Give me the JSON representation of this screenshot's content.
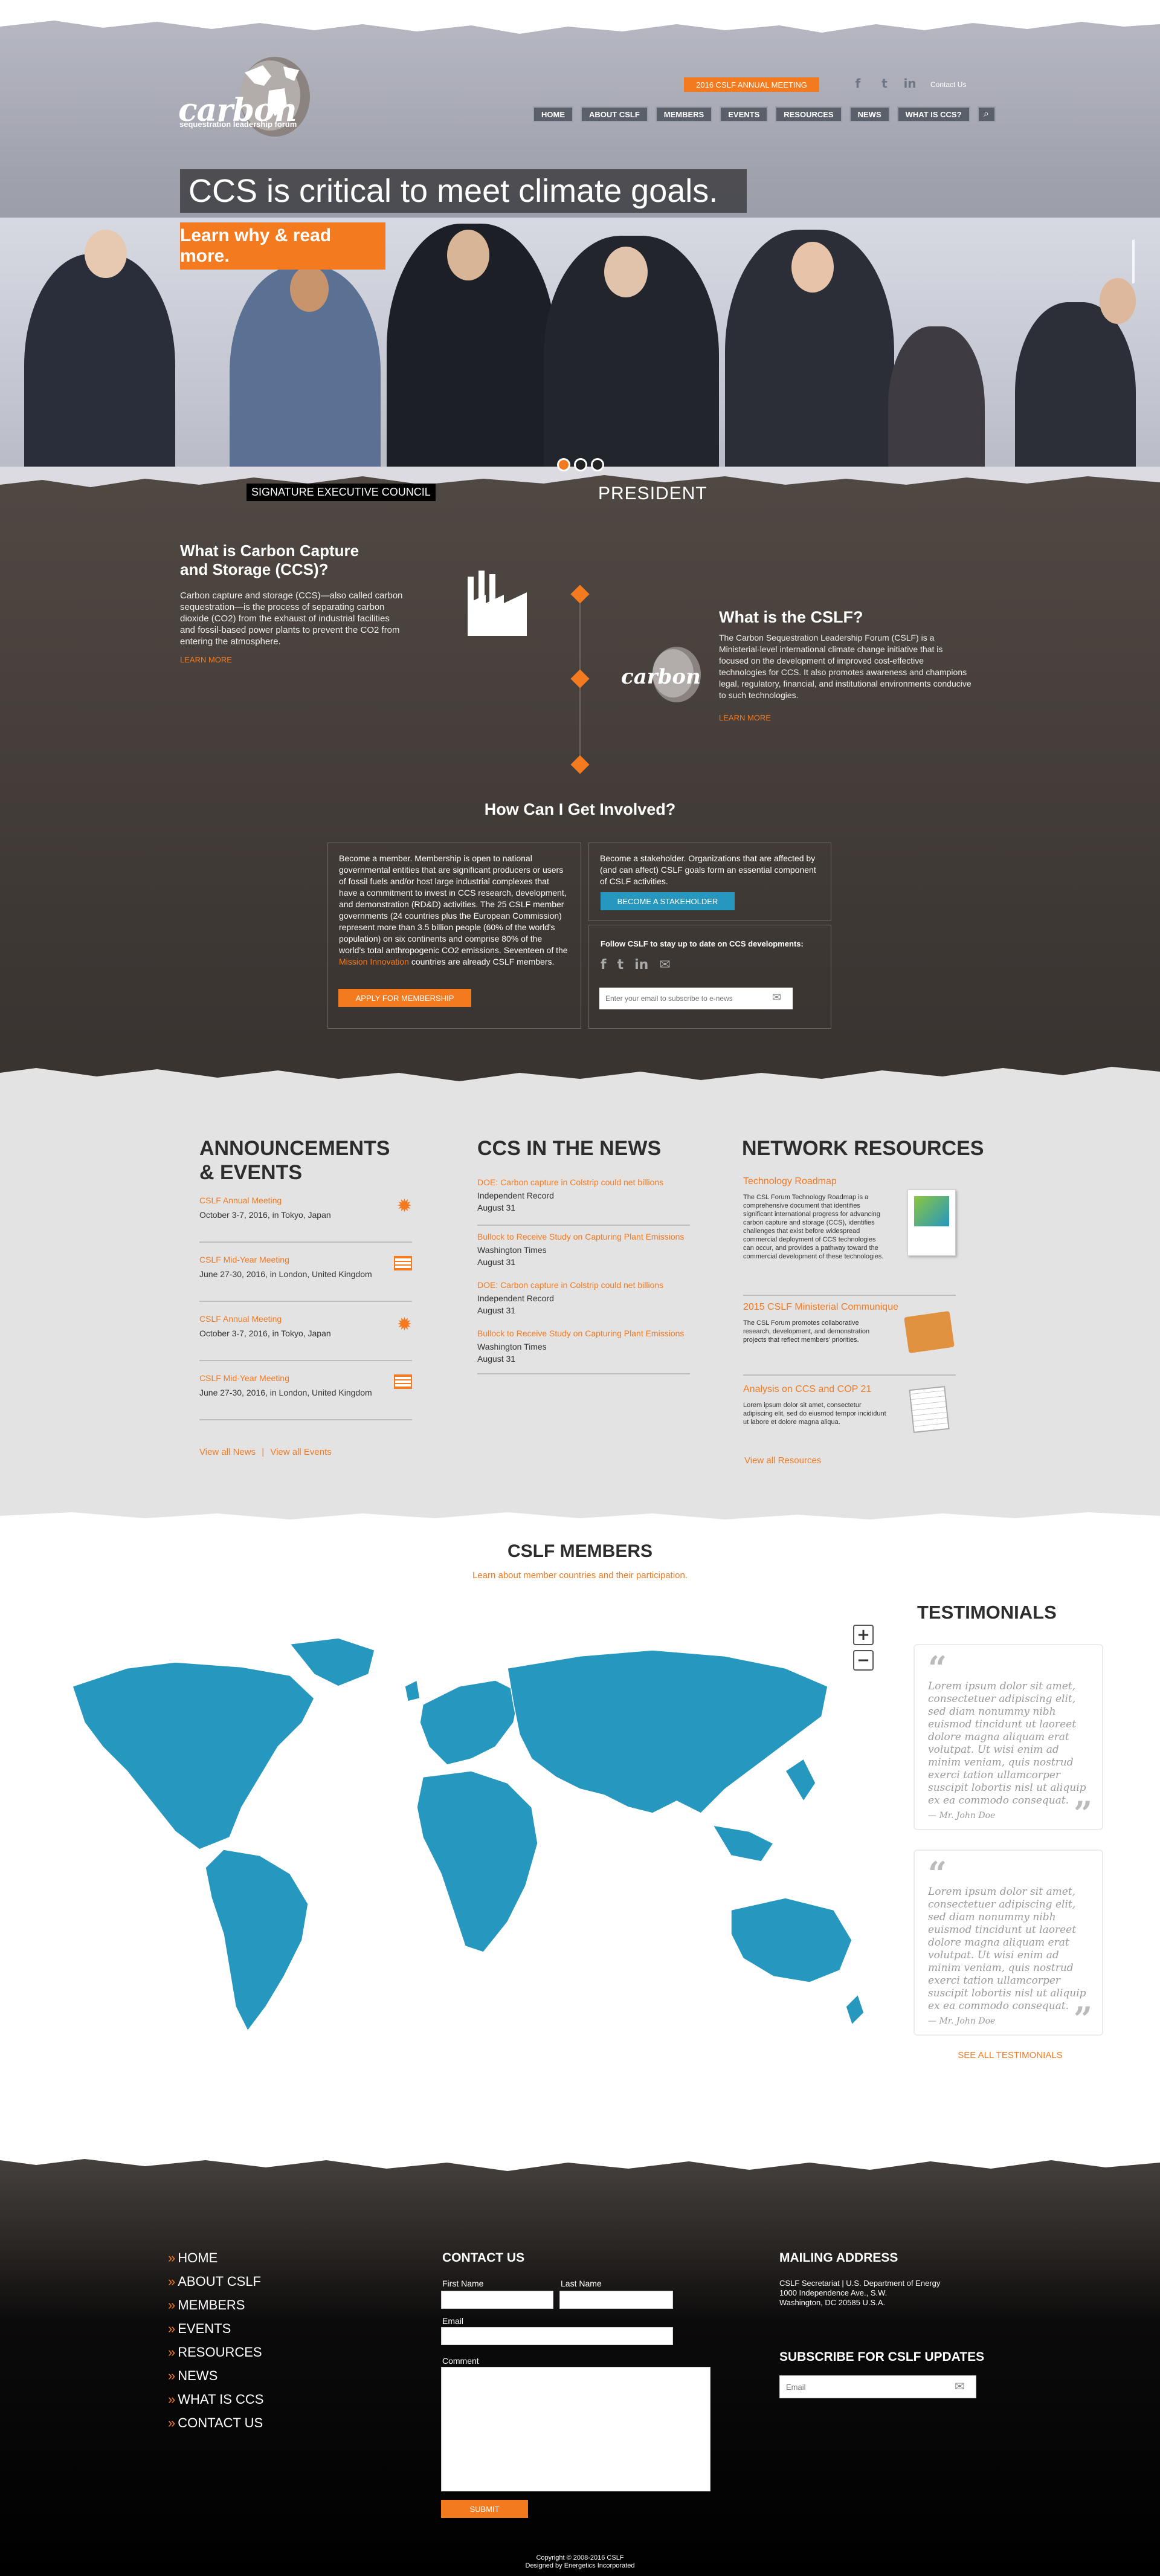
{
  "header": {
    "logo_word": "carbon",
    "logo_sub": "sequestration leadership forum",
    "announcement_button": "2016 CSLF ANNUAL MEETING",
    "contact": "Contact Us",
    "nav": [
      "HOME",
      "ABOUT CSLF",
      "MEMBERS",
      "EVENTS",
      "RESOURCES",
      "NEWS",
      "WHAT IS CCS?"
    ],
    "search_icon": "search-icon",
    "social_icons": [
      "facebook-icon",
      "twitter-icon",
      "linkedin-icon"
    ]
  },
  "hero": {
    "headline": "CCS is critical to meet climate goals.",
    "cta": "Learn why & read more.",
    "caption_left": "SIGNATURE EXECUTIVE COUNCIL",
    "caption_right": "PRESIDENT",
    "slide_count": 3,
    "active_slide": 1
  },
  "ccs": {
    "title": "What is Carbon Capture and Storage (CCS)?",
    "body": "Carbon capture and storage (CCS)—also called carbon sequestration—is the process of separating carbon dioxide (CO2) from the exhaust of industrial facilities and fossil-based power plants to prevent the CO2 from entering the atmosphere.",
    "link": "LEARN MORE",
    "icon": "factory-icon"
  },
  "cslf": {
    "title": "What is the CSLF?",
    "body": "The Carbon Sequestration Leadership Forum (CSLF) is a Ministerial-level international climate change initiative that is focused on the development of improved cost-effective technologies for CCS. It also promotes awareness and champions legal, regulatory, financial, and institutional environments conducive to such technologies.",
    "link": "LEARN MORE"
  },
  "involved": {
    "title": "How Can I Get Involved?",
    "member_text_1": "Become a member. Membership is open to national governmental entities that are significant producers or users of fossil fuels and/or host large industrial complexes that have a commitment to invest in CCS research, development, and demonstration (RD&D) activities. The 25 CSLF member governments (24 countries plus the European Commission) represent more than 3.5 billion people (60% of the world's population) on six continents and comprise 80% of the world's total anthropogenic CO2 emissions. Seventeen of the ",
    "member_link": "Mission Innovation",
    "member_text_2": " countries are already CSLF members.",
    "member_button": "APPLY FOR MEMBERSHIP",
    "stakeholder_text": "Become a stakeholder. Organizations that are affected by (and can affect) CSLF goals form an essential component of CSLF activities.",
    "stakeholder_button": "BECOME A STAKEHOLDER",
    "follow_text": "Follow CSLF to stay up to date on CCS developments:",
    "email_placeholder": "Enter your email to subscribe to e-news"
  },
  "announcements": {
    "title": "ANNOUNCEMENTS & EVENTS",
    "items": [
      {
        "title": "CSLF Annual Meeting",
        "date": "October 3-7, 2016, in Tokyo, Japan",
        "icon": "sun-icon"
      },
      {
        "title": "CSLF Mid-Year Meeting",
        "date": "June 27-30, 2016, in London, United Kingdom",
        "icon": "flag-icon"
      },
      {
        "title": "CSLF Annual Meeting",
        "date": "October 3-7, 2016, in Tokyo, Japan",
        "icon": "sun-icon"
      },
      {
        "title": "CSLF Mid-Year Meeting",
        "date": "June 27-30, 2016, in London, United Kingdom",
        "icon": "flag-icon"
      }
    ],
    "view_news": "View all News",
    "divider": "|",
    "view_events": "View all Events"
  },
  "news": {
    "title": "CCS IN THE NEWS",
    "items": [
      {
        "title": "DOE: Carbon capture in Colstrip could net billions",
        "source": "Independent Record",
        "date": "August 31"
      },
      {
        "title": "Bullock to Receive Study on Capturing Plant Emissions",
        "source": "Washington Times",
        "date": "August 31"
      },
      {
        "title": "DOE: Carbon capture in Colstrip could net billions",
        "source": "Independent Record",
        "date": "August 31"
      },
      {
        "title": "Bullock to Receive Study on Capturing Plant Emissions",
        "source": "Washington Times",
        "date": "August 31"
      }
    ]
  },
  "resources": {
    "title": "NETWORK RESOURCES",
    "items": [
      {
        "title": "Technology Roadmap",
        "body": "The CSL Forum Technology Roadmap is a comprehensive document that identifies significant international progress for advancing carbon capture and storage (CCS), identifies challenges that exist before widespread commercial deployment of CCS technologies can occur, and provides a pathway toward the commercial development of these technologies.",
        "icon": "document-thumbnail-icon"
      },
      {
        "title": "2015 CSLF Ministerial Communique",
        "body": "The CSL Forum promotes collaborative research, development, and demonstration projects that reflect members' priorities.",
        "icon": "folder-icon"
      },
      {
        "title": "Analysis on CCS and COP 21",
        "body": "Lorem ipsum dolor sit amet, consectetur adipiscing elit, sed do eiusmod tempor incididunt ut labore et dolore magna aliqua.",
        "icon": "paper-icon"
      }
    ],
    "view_all": "View all Resources"
  },
  "members": {
    "title": "CSLF MEMBERS",
    "subtitle": "Learn about member countries and their participation.",
    "zoom_in": "+",
    "zoom_out": "−"
  },
  "testimonials": {
    "title": "TESTIMONIALS",
    "items": [
      {
        "quote": "Lorem ipsum dolor sit amet, consectetuer adipiscing elit, sed diam nonummy nibh euismod tincidunt ut laoreet dolore magna aliquam erat volutpat. Ut wisi enim ad minim veniam, quis nostrud exerci tation ullamcorper suscipit lobortis nisl ut aliquip ex ea commodo consequat.",
        "author": "— Mr. John Doe"
      },
      {
        "quote": "Lorem ipsum dolor sit amet, consectetuer adipiscing elit, sed diam nonummy nibh euismod tincidunt ut laoreet dolore magna aliquam erat volutpat. Ut wisi enim ad minim veniam, quis nostrud exerci tation ullamcorper suscipit lobortis nisl ut aliquip ex ea commodo consequat.",
        "author": "— Mr. John Doe"
      }
    ],
    "see_all": "SEE ALL TESTIMONIALS"
  },
  "footer": {
    "nav": [
      "HOME",
      "ABOUT CSLF",
      "MEMBERS",
      "EVENTS",
      "RESOURCES",
      "NEWS",
      "WHAT IS CCS",
      "CONTACT US"
    ],
    "contact_title": "CONTACT US",
    "first_name": "First Name",
    "last_name": "Last Name",
    "email": "Email",
    "comment": "Comment",
    "submit": "SUBMIT",
    "mailing_title": "MAILING ADDRESS",
    "address_1": "CSLF Secretariat | U.S. Department of Energy",
    "address_2": "1000 Independence Ave., S.W.",
    "address_3": "Washington, DC 20585 U.S.A.",
    "subscribe_title": "SUBSCRIBE FOR CSLF UPDATES",
    "subscribe_placeholder": "Email",
    "copyright": "Copyright © 2008-2016 CSLF",
    "designed": "Designed by Energetics Incorporated"
  },
  "colors": {
    "accent": "#f47a20",
    "blue": "#2697bf",
    "dark": "#3f3834",
    "gray": "#e3e3e3"
  }
}
